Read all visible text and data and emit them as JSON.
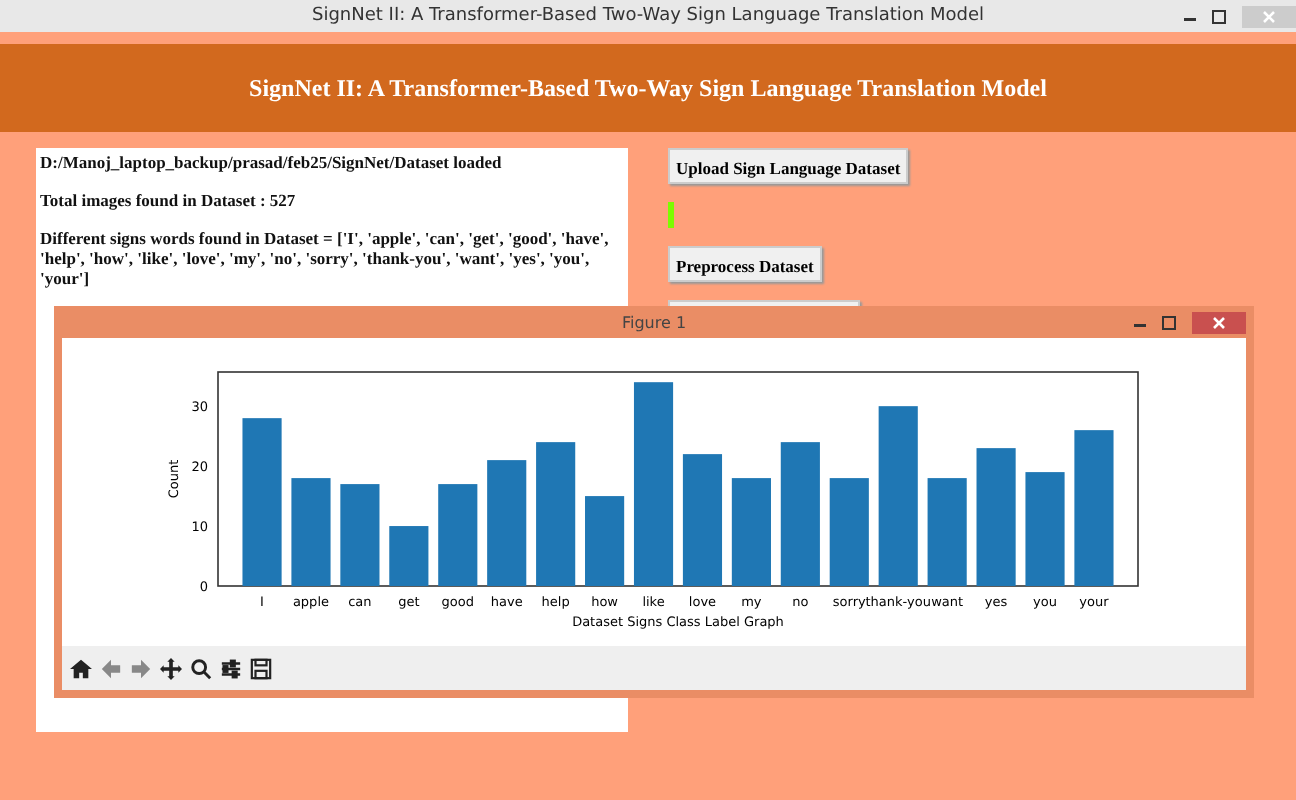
{
  "window": {
    "title": "SignNet II: A Transformer-Based Two-Way Sign Language Translation Model"
  },
  "header": {
    "title": "SignNet II: A Transformer-Based Two-Way Sign Language Translation Model"
  },
  "output_lines": [
    "D:/Manoj_laptop_backup/prasad/feb25/SignNet/Dataset loaded",
    "Total images found in Dataset : 527",
    "Different signs words found in Dataset = ['I', 'apple', 'can', 'get', 'good', 'have', 'help', 'how', 'like', 'love', 'my', 'no', 'sorry', 'thank-you', 'want', 'yes', 'you', 'your']"
  ],
  "buttons": [
    {
      "kind": "button",
      "label": "Upload Sign Language Dataset"
    },
    {
      "kind": "indicator"
    },
    {
      "kind": "button",
      "label": "Preprocess Dataset"
    },
    {
      "kind": "hidden"
    }
  ],
  "figure": {
    "title": "Figure 1",
    "chart_data": {
      "type": "bar",
      "xlabel": "Dataset Signs Class Label Graph",
      "ylabel": "Count",
      "categories": [
        "I",
        "apple",
        "can",
        "get",
        "good",
        "have",
        "help",
        "how",
        "like",
        "love",
        "my",
        "no",
        "sorry",
        "thank-you",
        "want",
        "yes",
        "you",
        "your"
      ],
      "series": [
        {
          "color": "#1f77b4",
          "values": [
            28,
            18,
            17,
            10,
            17,
            21,
            24,
            15,
            34,
            22,
            18,
            24,
            18,
            30,
            18,
            23,
            19,
            26
          ]
        }
      ],
      "ylim": [
        0,
        35.7
      ],
      "yticks": [
        0,
        10,
        20,
        30
      ]
    }
  }
}
